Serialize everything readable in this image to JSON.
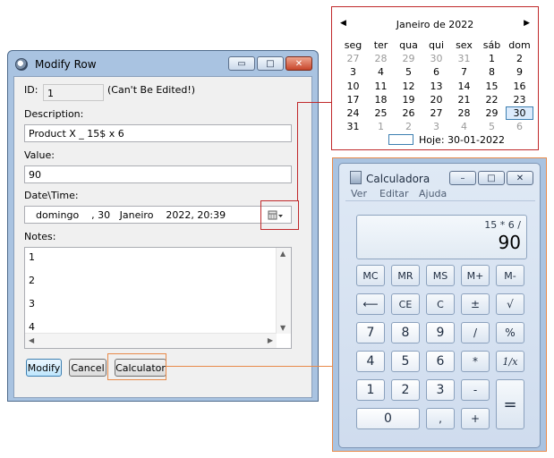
{
  "dialog": {
    "title": "Modify Row",
    "caption_buttons": {
      "minimize": "▭",
      "maximize": "□",
      "close": "✕"
    },
    "id_label": "ID:",
    "id_value": "1",
    "id_note": "(Can't Be Edited!)",
    "description_label": "Description:",
    "description_value": "Product X _ 15$ x 6",
    "value_label": "Value:",
    "value_value": "90",
    "datetime_label": "Date\\Time:",
    "datetime_value": "domingo    , 30   Janeiro    2022, 20:39",
    "notes_label": "Notes:",
    "notes_lines": [
      "1",
      "2",
      "3",
      "4"
    ],
    "buttons": {
      "modify": "Modify",
      "cancel": "Cancel",
      "calculator": "Calculator"
    }
  },
  "calendar": {
    "month_title": "Janeiro de 2022",
    "weekdays": [
      "seg",
      "ter",
      "qua",
      "qui",
      "sex",
      "sáb",
      "dom"
    ],
    "weeks": [
      [
        "27",
        "28",
        "29",
        "30",
        "31",
        "1",
        "2"
      ],
      [
        "3",
        "4",
        "5",
        "6",
        "7",
        "8",
        "9"
      ],
      [
        "10",
        "11",
        "12",
        "13",
        "14",
        "15",
        "16"
      ],
      [
        "17",
        "18",
        "19",
        "20",
        "21",
        "22",
        "23"
      ],
      [
        "24",
        "25",
        "26",
        "27",
        "28",
        "29",
        "30"
      ],
      [
        "31",
        "1",
        "2",
        "3",
        "4",
        "5",
        "6"
      ]
    ],
    "selected_day": "30",
    "today_label": "Hoje: 30-01-2022"
  },
  "calculator": {
    "title": "Calculadora",
    "menu": [
      "Ver",
      "Editar",
      "Ajuda"
    ],
    "expression": "15 * 6 /",
    "result": "90",
    "keys": {
      "mc": "MC",
      "mr": "MR",
      "ms": "MS",
      "mplus": "M+",
      "mminus": "M-",
      "back": "⟵",
      "ce": "CE",
      "c": "C",
      "plusminus": "±",
      "sqrt": "√",
      "7": "7",
      "8": "8",
      "9": "9",
      "div": "/",
      "pct": "%",
      "4": "4",
      "5": "5",
      "6": "6",
      "mul": "*",
      "recip": "1/x",
      "1": "1",
      "2": "2",
      "3": "3",
      "minus": "-",
      "equals": "=",
      "0": "0",
      "comma": ",",
      "plus": "+"
    }
  },
  "colors": {
    "highlight_red": "#c0292b",
    "highlight_orange": "#e88a4a",
    "window_frame": "#a9c3e1"
  }
}
